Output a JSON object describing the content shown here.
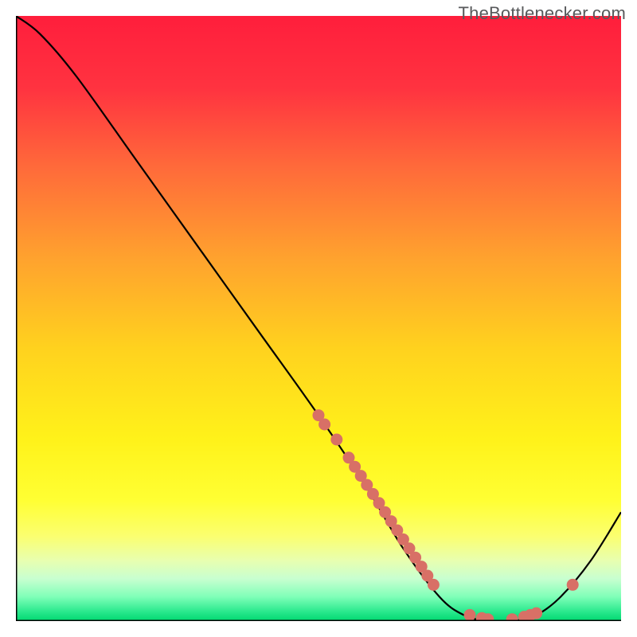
{
  "watermark": "TheBottlenecker.com",
  "chart_data": {
    "type": "line",
    "title": "",
    "xlabel": "",
    "ylabel": "",
    "xlim": [
      0,
      100
    ],
    "ylim": [
      0,
      100
    ],
    "curve": [
      {
        "x": 0,
        "y": 100
      },
      {
        "x": 4,
        "y": 97
      },
      {
        "x": 10,
        "y": 90
      },
      {
        "x": 20,
        "y": 76
      },
      {
        "x": 30,
        "y": 62
      },
      {
        "x": 40,
        "y": 48
      },
      {
        "x": 50,
        "y": 34
      },
      {
        "x": 58,
        "y": 22
      },
      {
        "x": 64,
        "y": 12
      },
      {
        "x": 70,
        "y": 4
      },
      {
        "x": 74,
        "y": 1
      },
      {
        "x": 78,
        "y": 0
      },
      {
        "x": 82,
        "y": 0
      },
      {
        "x": 86,
        "y": 1
      },
      {
        "x": 90,
        "y": 4
      },
      {
        "x": 95,
        "y": 10
      },
      {
        "x": 100,
        "y": 18
      }
    ],
    "dots": [
      {
        "x": 50,
        "y": 34
      },
      {
        "x": 51,
        "y": 32.5
      },
      {
        "x": 53,
        "y": 30
      },
      {
        "x": 55,
        "y": 27
      },
      {
        "x": 56,
        "y": 25.5
      },
      {
        "x": 57,
        "y": 24
      },
      {
        "x": 58,
        "y": 22.5
      },
      {
        "x": 59,
        "y": 21
      },
      {
        "x": 60,
        "y": 19.5
      },
      {
        "x": 61,
        "y": 18
      },
      {
        "x": 62,
        "y": 16.5
      },
      {
        "x": 63,
        "y": 15
      },
      {
        "x": 64,
        "y": 13.5
      },
      {
        "x": 65,
        "y": 12
      },
      {
        "x": 66,
        "y": 10.5
      },
      {
        "x": 67,
        "y": 9
      },
      {
        "x": 68,
        "y": 7.5
      },
      {
        "x": 69,
        "y": 6
      },
      {
        "x": 75,
        "y": 1
      },
      {
        "x": 77,
        "y": 0.5
      },
      {
        "x": 78,
        "y": 0.3
      },
      {
        "x": 82,
        "y": 0.3
      },
      {
        "x": 84,
        "y": 0.7
      },
      {
        "x": 85,
        "y": 1
      },
      {
        "x": 86,
        "y": 1.3
      },
      {
        "x": 92,
        "y": 6
      }
    ],
    "gradient_stops": [
      {
        "offset": 0.0,
        "color": "#ff1e3c"
      },
      {
        "offset": 0.12,
        "color": "#ff3340"
      },
      {
        "offset": 0.25,
        "color": "#ff6a3a"
      },
      {
        "offset": 0.4,
        "color": "#ffa22e"
      },
      {
        "offset": 0.55,
        "color": "#ffd21e"
      },
      {
        "offset": 0.7,
        "color": "#fff21a"
      },
      {
        "offset": 0.8,
        "color": "#ffff33"
      },
      {
        "offset": 0.86,
        "color": "#fbff70"
      },
      {
        "offset": 0.9,
        "color": "#e8ffb0"
      },
      {
        "offset": 0.93,
        "color": "#c8ffd0"
      },
      {
        "offset": 0.96,
        "color": "#7fffb8"
      },
      {
        "offset": 0.985,
        "color": "#28e88c"
      },
      {
        "offset": 1.0,
        "color": "#00d870"
      }
    ],
    "dot_color": "#d87066",
    "curve_color": "#000000",
    "axis_color": "#000000"
  }
}
